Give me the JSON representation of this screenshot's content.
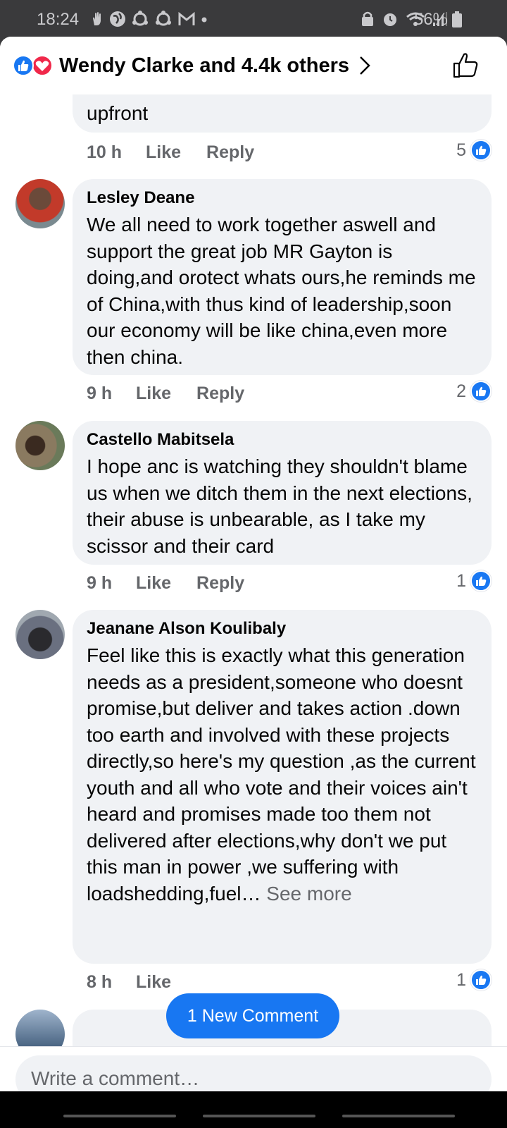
{
  "status_bar": {
    "time": "18:24",
    "battery": "56%",
    "notification_icons": [
      "hand-icon",
      "globe-icon",
      "sync-icon",
      "sync-icon",
      "gmail-icon",
      "dot-icon"
    ]
  },
  "header": {
    "title": "Wendy Clarke and 4.4k others"
  },
  "comments": [
    {
      "name": "",
      "text": "upfront",
      "time": "10 h",
      "like_label": "Like",
      "reply_label": "Reply",
      "like_count": "5"
    },
    {
      "name": "Lesley Deane",
      "text": "We all need to work together aswell and support the great job MR Gayton is doing,and orotect whats ours,he reminds me of China,with thus kind of leadership,soon our economy will be like china,even more then china.",
      "time": "9 h",
      "like_label": "Like",
      "reply_label": "Reply",
      "like_count": "2"
    },
    {
      "name": "Castello Mabitsela",
      "text": "I hope anc is watching they shouldn't blame us when we ditch them in the next elections, their abuse is unbearable, as I take my scissor and their card",
      "time": "9 h",
      "like_label": "Like",
      "reply_label": "Reply",
      "like_count": "1"
    },
    {
      "name": "Jeanane Alson Koulibaly",
      "text": "Feel like this is exactly what this generation needs as a president,someone who doesnt promise,but deliver and takes action .down too earth and involved with these projects directly,so here's my question ,as the current youth and all who vote and their voices ain't heard and promises made too them not delivered after elections,why don't we put this man in power ,we suffering with loadshedding,fuel…",
      "see_more": "See more",
      "time": "8 h",
      "like_label": "Like",
      "like_count": "1"
    }
  ],
  "new_comment_label": "1 New Comment",
  "composer": {
    "placeholder": "Write a comment…"
  },
  "colors": {
    "accent": "#1877f2",
    "love": "#f0284a",
    "bubble": "#f0f2f5",
    "secondary_text": "#65676b"
  }
}
